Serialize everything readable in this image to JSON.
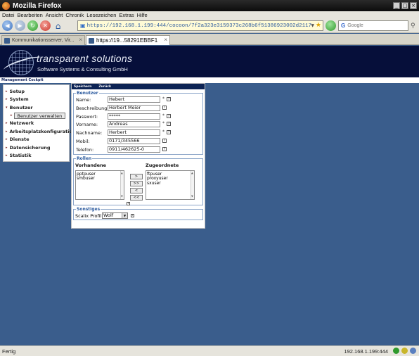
{
  "window": {
    "title": "Mozilla Firefox"
  },
  "menu": [
    "Datei",
    "Bearbeiten",
    "Ansicht",
    "Chronik",
    "Lesezeichen",
    "Extras",
    "Hilfe"
  ],
  "nav": {
    "url": "https://192.168.1.199:444/cocoon/7f2a323e3159373c268b6f51386923002d2117",
    "search_placeholder": "Google"
  },
  "tabs": [
    {
      "label": "Kommunikationsserver, Vir...",
      "active": false
    },
    {
      "label": "https://19...58291EBBF1",
      "active": true
    }
  ],
  "banner": {
    "company": "transparent solutions",
    "subtitle": "Software Systems & Consulting GmbH",
    "section": "Management Cockpit"
  },
  "sidebar": {
    "items": [
      {
        "label": "Setup"
      },
      {
        "label": "System"
      },
      {
        "label": "Benutzer"
      },
      {
        "label": "Netzwerk"
      },
      {
        "label": "Arbeitsplatzkonfiguration"
      },
      {
        "label": "Dienste"
      },
      {
        "label": "Datensicherung"
      },
      {
        "label": "Statistik"
      }
    ],
    "subitem": "Benutzer verwalten"
  },
  "actions": {
    "save": "Speichern",
    "back": "Zurück"
  },
  "benutzer": {
    "legend": "Benutzer",
    "fields": [
      {
        "label": "Name:",
        "value": "Hebert",
        "required": true
      },
      {
        "label": "Beschreibung:",
        "value": "Herbert Meier",
        "required": false
      },
      {
        "label": "Passwort:",
        "value": "*****",
        "required": true
      },
      {
        "label": "Vorname:",
        "value": "Andreas",
        "required": true
      },
      {
        "label": "Nachname:",
        "value": "Herbert",
        "required": true
      },
      {
        "label": "Mobil:",
        "value": "0171/345566",
        "required": false
      },
      {
        "label": "Telefon:",
        "value": "0911/462625-0",
        "required": false
      }
    ],
    "required_mark": "*"
  },
  "rollen": {
    "legend": "Rollen",
    "available_header": "Vorhandene",
    "assigned_header": "Zugeordnete",
    "available": [
      "pptpuser",
      "smbuser"
    ],
    "assigned": [
      "ftpuser",
      "proxyuser",
      "sxuser"
    ],
    "buttons": [
      ">",
      ">>",
      "<",
      "<<"
    ]
  },
  "sonstiges": {
    "legend": "Sonstiges",
    "label": "Scalix Profil",
    "value": "Wolf"
  },
  "status": {
    "text": "Fertig",
    "host": "192.168.1.199:444"
  }
}
